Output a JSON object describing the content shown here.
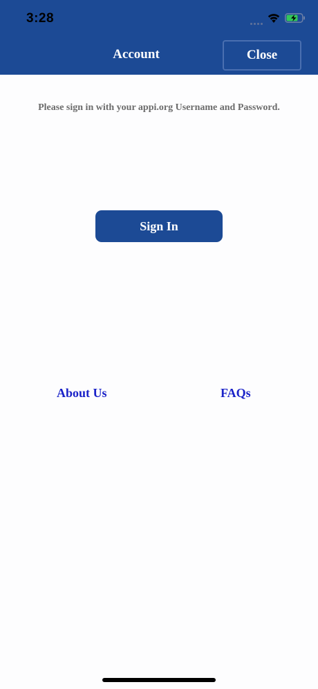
{
  "status_bar": {
    "time": "3:28",
    "icons": [
      "cellular-signal-icon",
      "wifi-icon",
      "battery-charging-icon"
    ]
  },
  "header": {
    "title": "Account",
    "close_label": "Close"
  },
  "main": {
    "instruction": "Please sign in with your appi.org Username and Password.",
    "sign_in_label": "Sign In"
  },
  "links": {
    "about_label": "About Us",
    "faqs_label": "FAQs"
  },
  "colors": {
    "header_bg": "#1c4a95",
    "link": "#1a22c8",
    "instruction_text": "#6b6b6b",
    "battery_fill": "#33c759"
  }
}
